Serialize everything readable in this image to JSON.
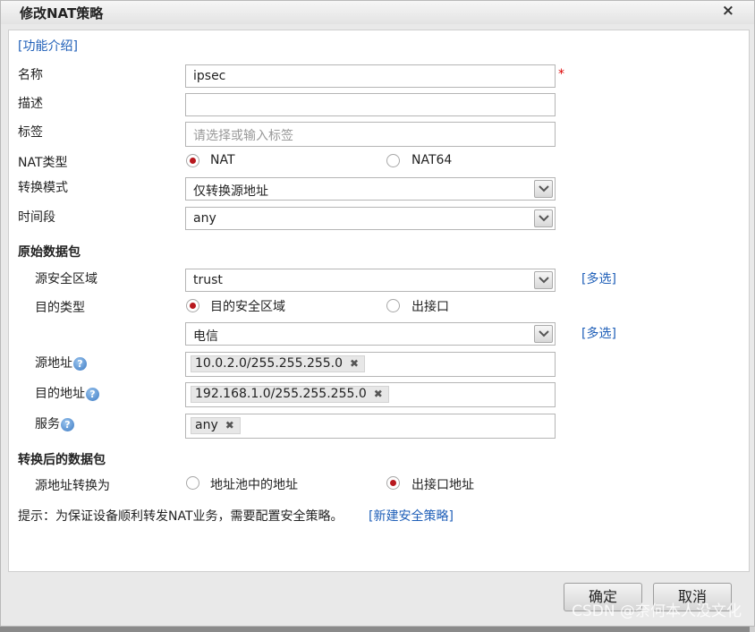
{
  "dialog": {
    "title": "修改NAT策略",
    "close": "×",
    "feature_link": "[功能介绍]"
  },
  "form": {
    "name": {
      "label": "名称",
      "value": "ipsec",
      "required_mark": "*"
    },
    "description": {
      "label": "描述",
      "value": ""
    },
    "tags": {
      "label": "标签",
      "placeholder": "请选择或输入标签"
    },
    "nat_type": {
      "label": "NAT类型",
      "options": [
        "NAT",
        "NAT64"
      ],
      "selected": "NAT"
    },
    "convert_mode": {
      "label": "转换模式",
      "value": "仅转换源地址"
    },
    "time_range": {
      "label": "时间段",
      "value": "any"
    }
  },
  "original_packet": {
    "section_title": "原始数据包",
    "src_zone": {
      "label": "源安全区域",
      "value": "trust",
      "multi_link": "[多选]"
    },
    "dest_type": {
      "label": "目的类型",
      "options": [
        "目的安全区域",
        "出接口"
      ],
      "selected": "目的安全区域"
    },
    "dest_zone": {
      "value": "电信",
      "multi_link": "[多选]"
    },
    "src_addr": {
      "label": "源地址",
      "tags": [
        "10.0.2.0/255.255.255.0"
      ]
    },
    "dest_addr": {
      "label": "目的地址",
      "tags": [
        "192.168.1.0/255.255.255.0"
      ]
    },
    "service": {
      "label": "服务",
      "tags": [
        "any"
      ]
    }
  },
  "translated_packet": {
    "section_title": "转换后的数据包",
    "src_translate": {
      "label": "源地址转换为",
      "options": [
        "地址池中的地址",
        "出接口地址"
      ],
      "selected": "出接口地址"
    }
  },
  "hint": {
    "text": "提示：为保证设备顺利转发NAT业务，需要配置安全策略。",
    "link": "[新建安全策略]"
  },
  "buttons": {
    "ok": "确定",
    "cancel": "取消"
  },
  "watermark": "CSDN @奈何本人没文化",
  "colors": {
    "accent_red": "#b8191f",
    "link_blue": "#1f5fb8"
  },
  "icons": {
    "help": "?",
    "close": "×",
    "tag_remove": "✖"
  }
}
